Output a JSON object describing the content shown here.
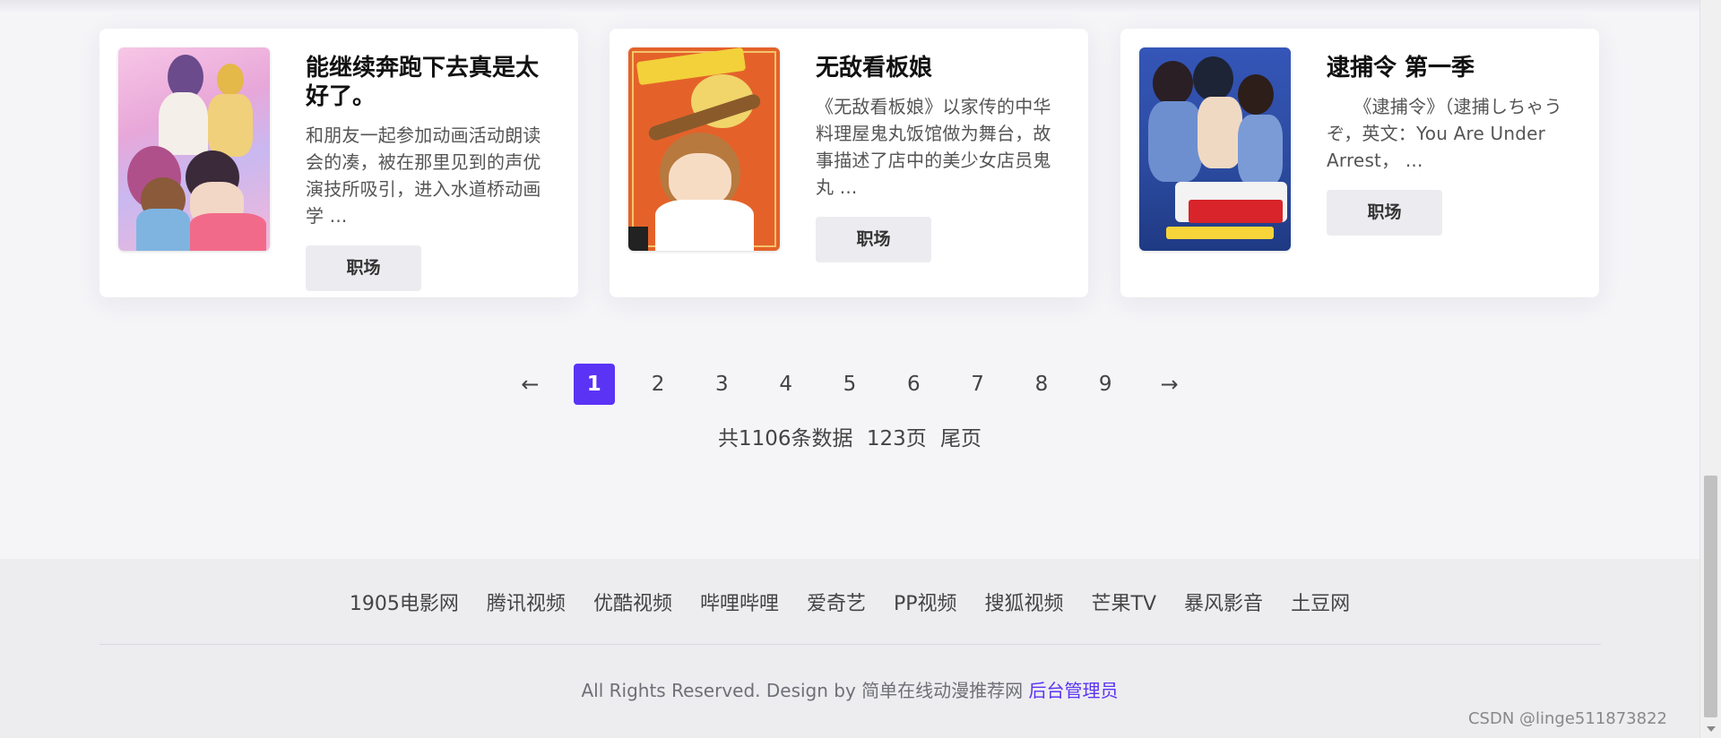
{
  "cards": [
    {
      "title": "能继续奔跑下去真是太好了。",
      "description": "和朋友一起参加动画活动朗读会的凑，被在那里见到的声优演技所吸引，进入水道桥动画学 ...",
      "button_label": "职场"
    },
    {
      "title": "无敌看板娘",
      "description": "《无敌看板娘》以家传的中华料理屋鬼丸饭馆做为舞台，故事描述了店中的美少女店员鬼丸 ...",
      "button_label": "职场"
    },
    {
      "title": "逮捕令 第一季",
      "description": "　　《逮捕令》（逮捕しちゃうぞ，英文：You Are Under Arrest， ...",
      "button_label": "职场"
    }
  ],
  "pagination": {
    "prev": "←",
    "next": "→",
    "pages": [
      "1",
      "2",
      "3",
      "4",
      "5",
      "6",
      "7",
      "8",
      "9"
    ],
    "current": "1",
    "total_records": "共1106条数据",
    "total_pages": "123页",
    "last_page_label": "尾页"
  },
  "footer": {
    "links": [
      "1905电影网",
      "腾讯视频",
      "优酷视频",
      "哔哩哔哩",
      "爱奇艺",
      "PP视频",
      "搜狐视频",
      "芒果TV",
      "暴风影音",
      "土豆网"
    ],
    "copyright": "All Rights Reserved. Design by 简单在线动漫推荐网",
    "admin_link": "后台管理员"
  },
  "watermark": "CSDN @linge511873822",
  "colors": {
    "accent": "#5b33f5",
    "background": "#f5f5f8",
    "footer_bg": "#ededf0"
  }
}
